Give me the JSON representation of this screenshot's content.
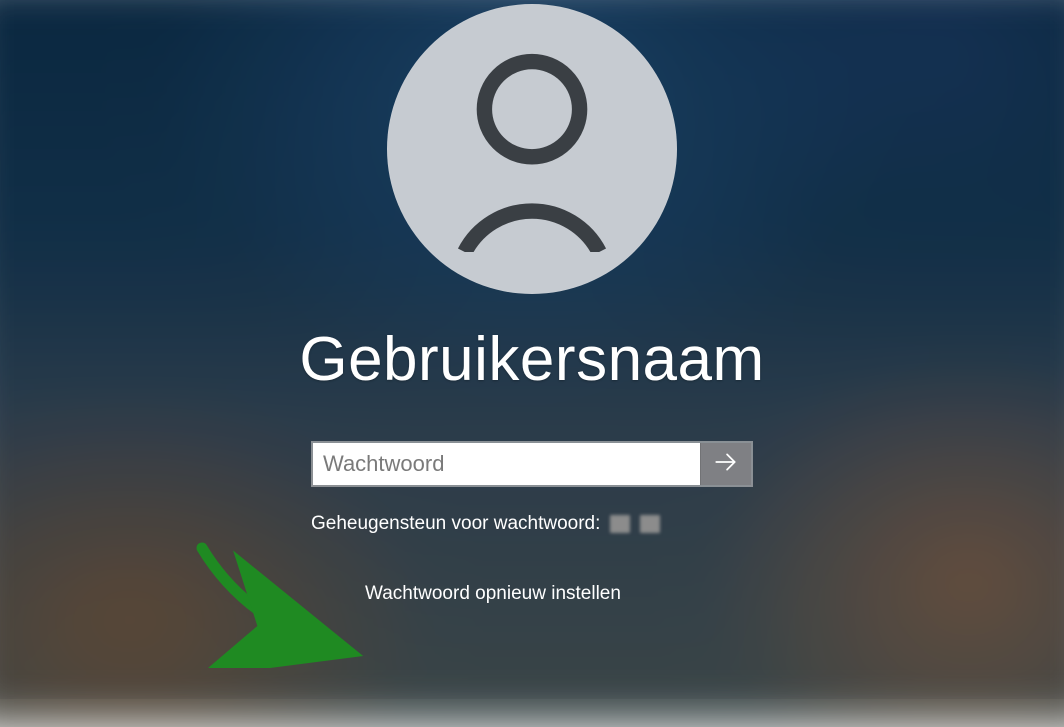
{
  "account": {
    "username": "Gebruikersnaam"
  },
  "password": {
    "placeholder": "Wachtwoord",
    "value": ""
  },
  "hint": {
    "label": "Geheugensteun voor wachtwoord:"
  },
  "links": {
    "reset_password": "Wachtwoord opnieuw instellen"
  },
  "icons": {
    "avatar": "person-icon",
    "submit": "arrow-right-icon"
  },
  "colors": {
    "avatar_bg": "#c6cbd1",
    "submit_bg": "#7f8084",
    "text": "#ffffff",
    "annotation_arrow": "#1f8a22"
  }
}
